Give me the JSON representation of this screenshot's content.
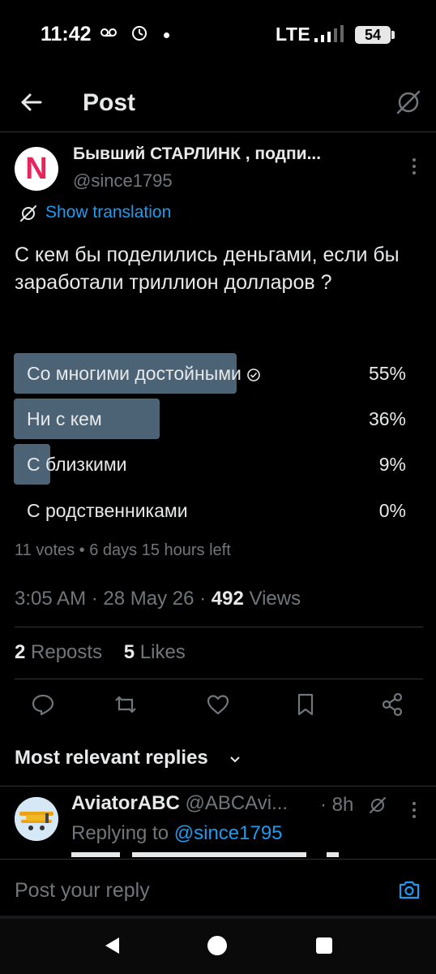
{
  "status_bar": {
    "time": "11:42",
    "network": "LTE",
    "battery": "54"
  },
  "header": {
    "title": "Post"
  },
  "author": {
    "avatar_letter": "N",
    "name": "Бывший СТАРЛИНК , подпи...",
    "handle": "@since1795"
  },
  "translate": "Show translation",
  "post_text": "С кем бы поделились деньгами, если бы заработали триллион долларов ?",
  "poll": {
    "options": [
      {
        "label": "Со многими достойными",
        "percent": "55%",
        "fill": 0.55,
        "winner": true
      },
      {
        "label": "Ни с кем",
        "percent": "36%",
        "fill": 0.36,
        "winner": false
      },
      {
        "label": "С близкими",
        "percent": "9%",
        "fill": 0.09,
        "winner": false
      },
      {
        "label": "С родственниками",
        "percent": "0%",
        "fill": 0,
        "winner": false
      }
    ],
    "meta": "11 votes • 6 days 15 hours left"
  },
  "timestamp": {
    "text": "3:05 AM · 28 May 26 · ",
    "views_count": "492",
    "views_label": " Views"
  },
  "stats": {
    "reposts_count": "2",
    "reposts_label": " Reposts",
    "likes_count": "5",
    "likes_label": " Likes"
  },
  "actions": [
    "reply-icon",
    "repost-icon",
    "like-icon",
    "bookmark-icon",
    "share-icon"
  ],
  "replies_header": "Most relevant replies",
  "reply": {
    "name": "AviatorABC",
    "handle": " @ABCAvi...",
    "time": "· 8h",
    "replying_prefix": "Replying to ",
    "replying_handle": "@since1795"
  },
  "compose": {
    "placeholder": "Post your reply"
  },
  "colors": {
    "accent": "#1d9bf0",
    "poll_fill": "#4c6375",
    "muted": "#71767b"
  }
}
